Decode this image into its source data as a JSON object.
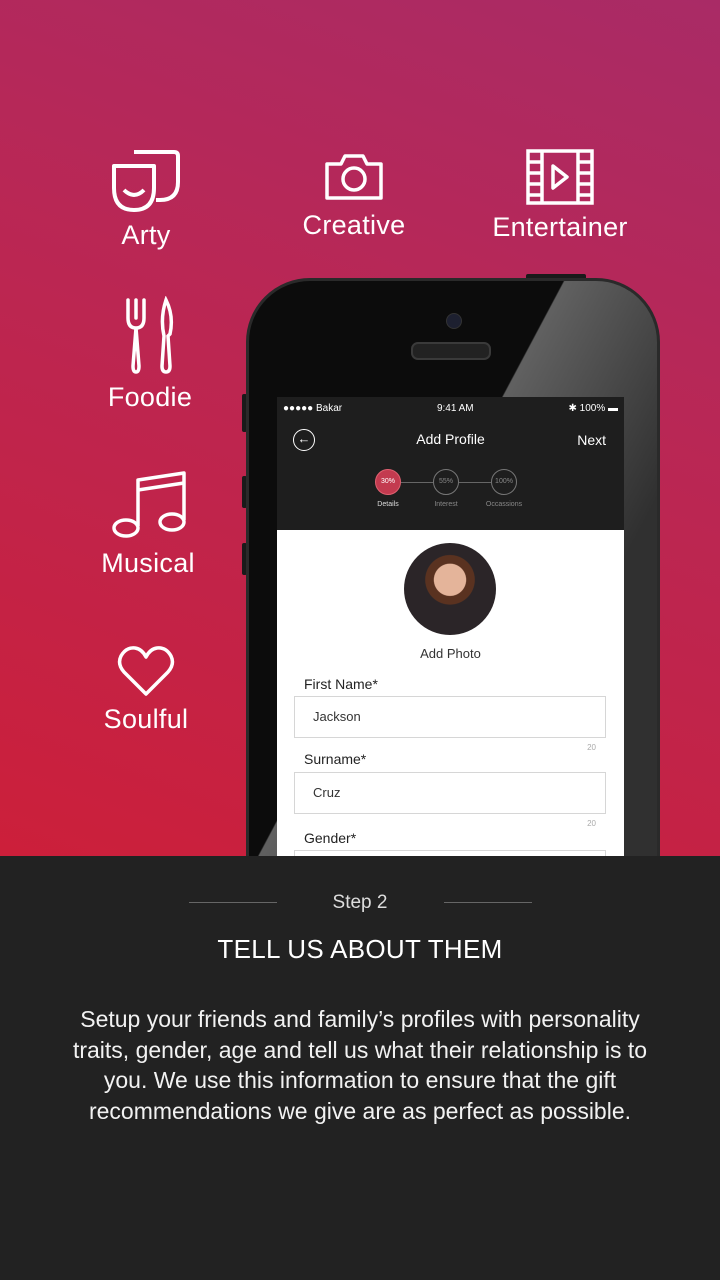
{
  "traits": [
    {
      "label": "Arty",
      "icon": "masks-icon"
    },
    {
      "label": "Creative",
      "icon": "camera-icon"
    },
    {
      "label": "Entertainer",
      "icon": "film-icon"
    },
    {
      "label": "Foodie",
      "icon": "cutlery-icon"
    },
    {
      "label": "Musical",
      "icon": "music-notes-icon"
    },
    {
      "label": "Soulful",
      "icon": "heart-icon"
    }
  ],
  "phone": {
    "status": {
      "carrier": "●●●●● Bakar",
      "time": "9:41 AM",
      "battery": "100%"
    },
    "nav": {
      "title": "Add Profile",
      "next": "Next",
      "back": "←"
    },
    "steps": [
      {
        "value": "30%",
        "label": "Details",
        "active": true
      },
      {
        "value": "55%",
        "label": "Interest",
        "active": false
      },
      {
        "value": "100%",
        "label": "Occassions",
        "active": false
      }
    ],
    "add_photo": "Add Photo",
    "form": {
      "first_name_label": "First Name*",
      "first_name_value": "Jackson",
      "first_name_counter": "20",
      "surname_label": "Surname*",
      "surname_value": "Cruz",
      "surname_counter": "20",
      "gender_label": "Gender*"
    }
  },
  "panel": {
    "step": "Step 2",
    "headline": "TELL US ABOUT THEM",
    "description": "Setup your friends and family’s profiles with personality traits, gender, age and tell us what their relationship is to you. We use this information to ensure that the gift recommendations we give are as perfect as possible."
  },
  "colors": {
    "accent": "#c33a4f",
    "panel_bg": "#222222",
    "gradient_top": "#a92b66",
    "gradient_bottom": "#cc1f3a"
  }
}
